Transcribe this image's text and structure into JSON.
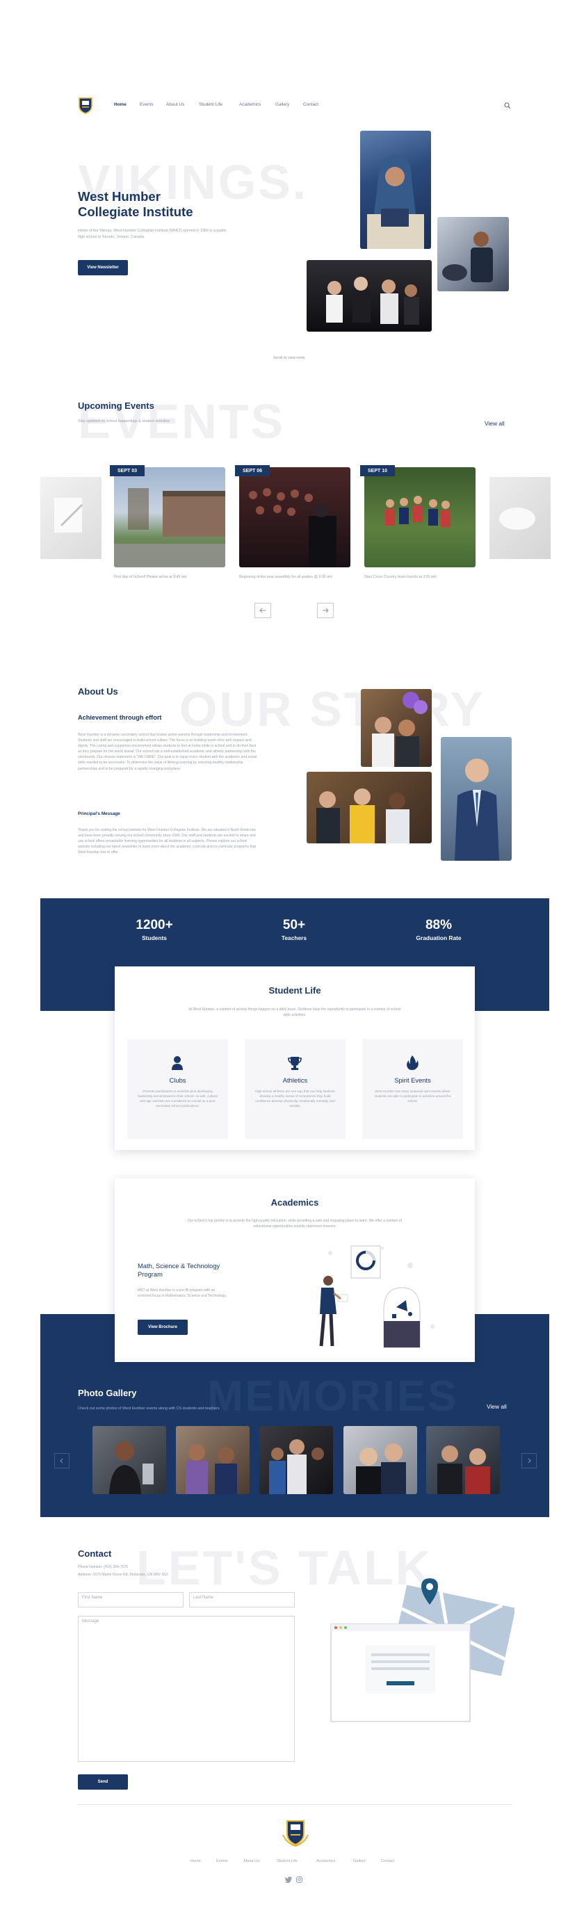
{
  "nav": {
    "items": [
      "Home",
      "Events",
      "About Us",
      "Student Life",
      "Academics",
      "Gallery",
      "Contact"
    ],
    "active": "Home"
  },
  "hero": {
    "bg_word": "VIKINGS.",
    "title_line1": "West Humber",
    "title_line2": "Collegiate Institute",
    "description": "Home of the Vikings, West Humber Collegiate Institute (WHCI) opened in 1966 is a public high school in Toronto, Ontario, Canada.",
    "button": "View Newsletter",
    "scroll_hint": "Scroll to view more"
  },
  "events": {
    "bg_word": "EVENTS",
    "title": "Upcoming Events",
    "subtitle": "Stay updated on school happenings & student activities",
    "view_all": "View all",
    "items": [
      {
        "date": "SEPT 03",
        "caption": "First day of School! Please arrive at 8:45 am"
      },
      {
        "date": "SEPT 06",
        "caption": "Beginning of the year assembly for all grades @ 9:00 am"
      },
      {
        "date": "SEPT 10",
        "caption": "Start Cross Country team tryouts at 3:00 pm"
      }
    ],
    "prev_icon": "arrow-left-icon",
    "next_icon": "arrow-right-icon"
  },
  "about": {
    "bg_word": "OUR STORY",
    "title": "About Us",
    "subtitle": "Achievement through effort",
    "paragraph": "West Humber is a dynamic secondary school that boasts active parents through leadership and involvement. Students and staff are encouraged to build school culture. The focus is on building warm ethic with respect and dignity. The caring and supportive environment allows students to feel at home while in school and to do their best as they prepare for the world ahead. Our school has a well-established academic and athletic partnership with the community. Our mission statement is \"WE CARE\". Our goal is to equip every student with the academic and social skills needed to be successful. To determine the value of lifelong learning by ensuring healthy relationship partnerships and to be prepared for a rapidly changing workplace.",
    "principal_heading": "Principal's Message",
    "principal_message": "Thank you for visiting the school website for West Humber Collegiate Institute. We are situated in North Etobicoke and have been proudly serving our school community since 1966. Our staff and students are excited to share and use school offers remarkable learning opportunities for all students in all subjects. Please explore our school website including our latest newsletter to learn more about the academic curricula and co-curricular programs that West Humber has to offer."
  },
  "stats": [
    {
      "value": "1200+",
      "label": "Students"
    },
    {
      "value": "50+",
      "label": "Teachers"
    },
    {
      "value": "88%",
      "label": "Graduation Rate"
    }
  ],
  "student_life": {
    "title": "Student Life",
    "intro": "At West Humber, a number of activity things happen on a daily basis. Students have the opportunity to participate in a number of school wide activities.",
    "items": [
      {
        "icon": "person-icon",
        "title": "Clubs",
        "text": "Promote participation in activities plus developing leadership demonstrated in their school. As well, cultural and age activities are considered an crucial as a pure secondary school publications."
      },
      {
        "icon": "trophy-icon",
        "title": "Athletics",
        "text": "High school athletics are one way that can help students develop a healthy sense of competence they build confidence develop physically, emotionally mentally, and socially."
      },
      {
        "icon": "flame-icon",
        "title": "Spirit Events",
        "text": "West Humber has many seasonal spirit events where students are able to participate in activities around the school."
      }
    ]
  },
  "academics": {
    "title": "Academics",
    "intro": "Our school's top priority is to provide the high-quality education, while providing a safe and engaging place to learn. We offer a number of educational opportunities outside classroom lessons.",
    "program_title_line1": "Math, Science & Technology",
    "program_title_line2": "Program",
    "program_text": "MST at West Humber is a pre-IB program with an enriched focus in Mathematics, Science and Technology.",
    "button": "View Brochure"
  },
  "gallery": {
    "bg_word": "MEMORIES",
    "title": "Photo Gallery",
    "subtitle": "Check out some photos of West Humber events along with CS students and teachers",
    "view_all": "View all"
  },
  "contact": {
    "bg_word": "LET'S TALK",
    "title": "Contact",
    "phone": "Phone Number: (416) 394-7570",
    "address": "Address: 1675 Martin Grove Rd, Etobicoke, ON M9V 3S3",
    "first_name": "First Name",
    "last_name": "Last Name",
    "message": "Message",
    "send": "Send"
  },
  "footer": {
    "links": [
      "Home",
      "Events",
      "About Us",
      "Student Life",
      "Academics",
      "Gallery",
      "Contact"
    ],
    "social": [
      "twitter-icon",
      "instagram-icon"
    ]
  },
  "colors": {
    "navy": "#1b3766",
    "gold": "#e5b435",
    "light_grey": "#f6f6f8"
  }
}
